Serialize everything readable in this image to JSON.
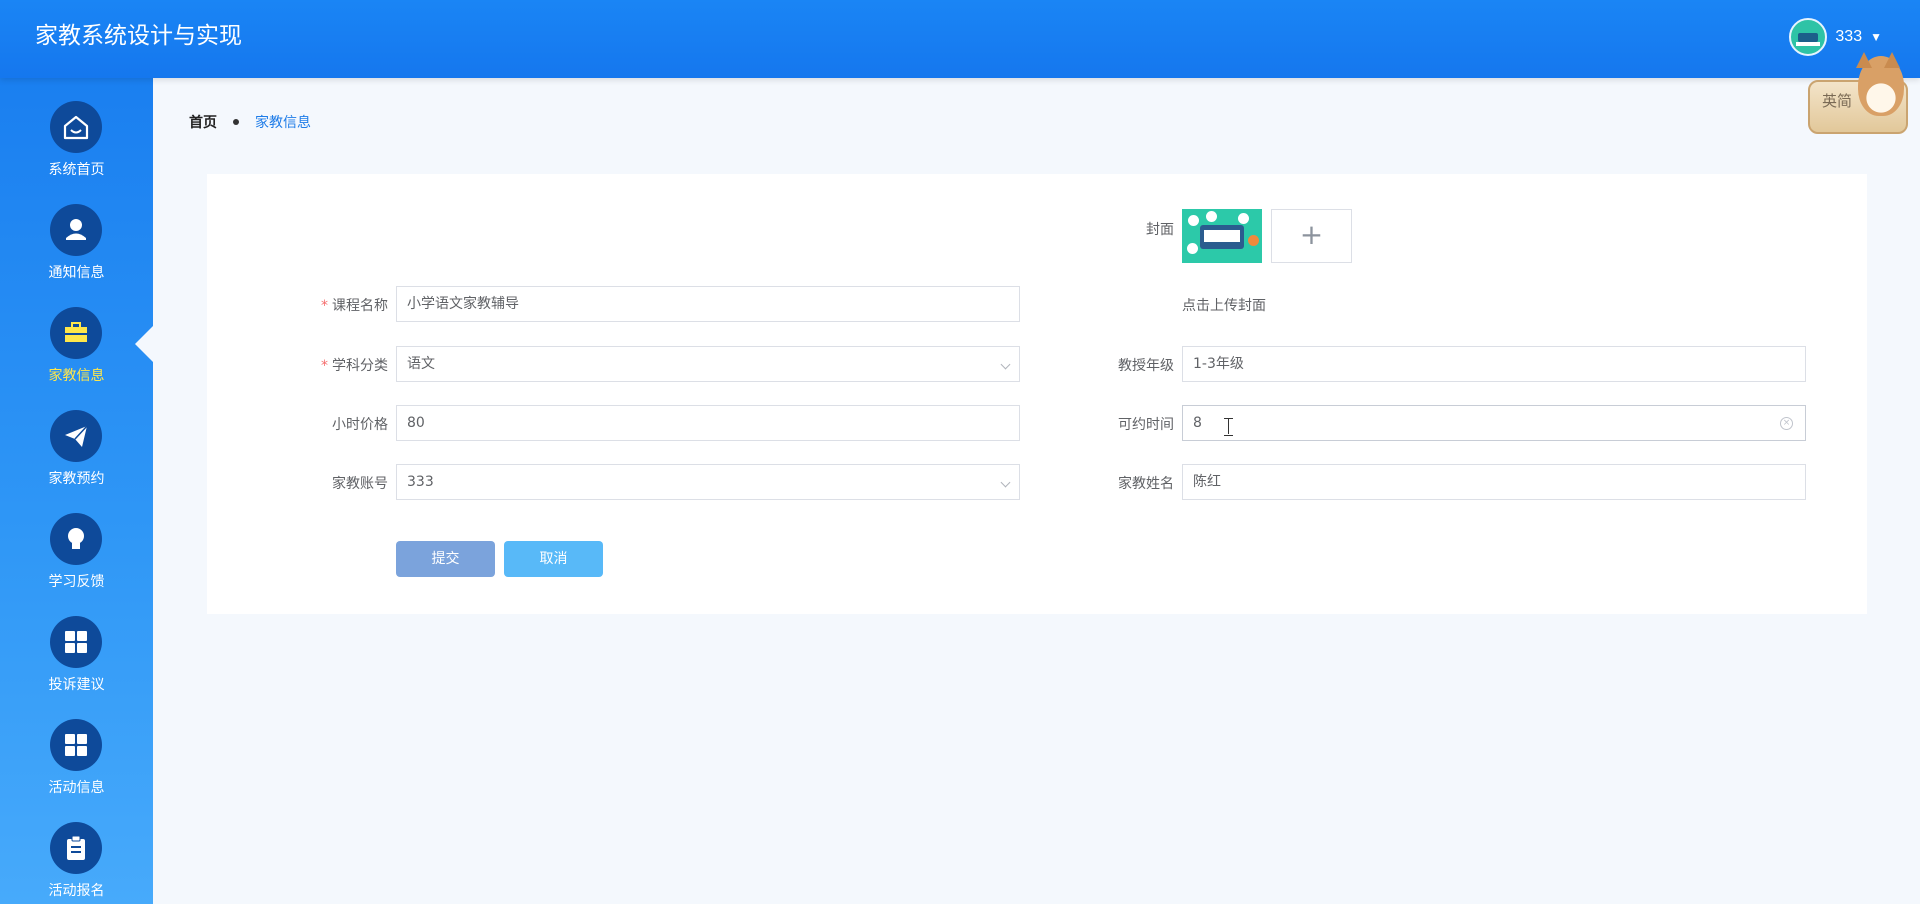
{
  "header": {
    "title": "家教系统设计与实现",
    "username": "333"
  },
  "badge": {
    "text": "英简"
  },
  "sidebar": {
    "items": [
      {
        "label": "系统首页",
        "icon": "home-icon"
      },
      {
        "label": "通知信息",
        "icon": "user-icon"
      },
      {
        "label": "家教信息",
        "icon": "briefcase-icon",
        "active": true
      },
      {
        "label": "家教预约",
        "icon": "paper-plane-icon"
      },
      {
        "label": "学习反馈",
        "icon": "lightbulb-icon"
      },
      {
        "label": "投诉建议",
        "icon": "grid-icon"
      },
      {
        "label": "活动信息",
        "icon": "grid-icon"
      },
      {
        "label": "活动报名",
        "icon": "clipboard-icon"
      }
    ]
  },
  "breadcrumb": {
    "home": "首页",
    "current": "家教信息"
  },
  "form": {
    "cover_label": "封面",
    "upload_hint": "点击上传封面",
    "course_name": {
      "label": "课程名称",
      "value": "小学语文家教辅导"
    },
    "subject": {
      "label": "学科分类",
      "value": "语文"
    },
    "grade": {
      "label": "教授年级",
      "value": "1-3年级"
    },
    "hourly_price": {
      "label": "小时价格",
      "value": "80"
    },
    "available_time": {
      "label": "可约时间",
      "value": "8"
    },
    "tutor_account": {
      "label": "家教账号",
      "value": "333"
    },
    "tutor_name": {
      "label": "家教姓名",
      "value": "陈红"
    },
    "submit_label": "提交",
    "cancel_label": "取消"
  },
  "colors": {
    "header_bg": "#1a85f5",
    "sidebar_bg": "#2f97f6",
    "active_label": "#ffe74a",
    "submit_button": "#7ba3dc",
    "cancel_button": "#58b9f8",
    "required_star": "#f56c6c"
  }
}
